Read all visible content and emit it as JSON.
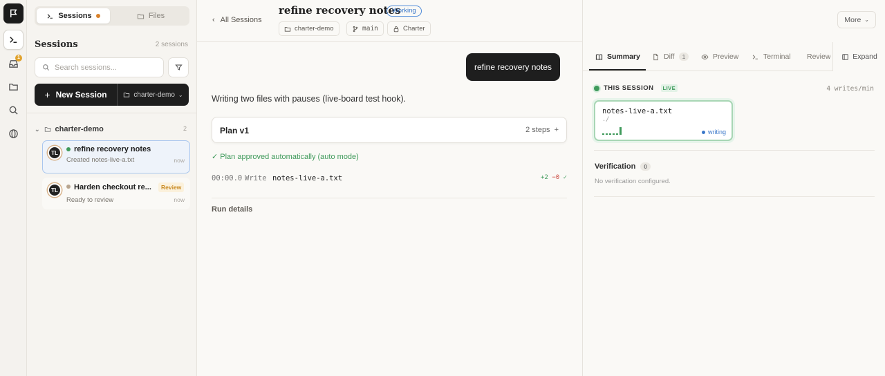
{
  "rail": {
    "inbox_count": "1"
  },
  "sidebar": {
    "tabs": [
      {
        "label": "Sessions"
      },
      {
        "label": "Files"
      }
    ],
    "title": "Sessions",
    "session_count": "2 sessions",
    "search_placeholder": "Search sessions...",
    "new_session_label": "New Session",
    "new_session_project": "charter-demo",
    "group": {
      "name": "charter-demo",
      "count": "2"
    },
    "sessions": [
      {
        "avatar": "TL",
        "title": "refine recovery notes",
        "subtitle": "Created notes-live-a.txt",
        "time": "now",
        "status_color": "#3f9a5b"
      },
      {
        "avatar": "TL",
        "title": "Harden checkout re...",
        "subtitle": "Ready to review",
        "time": "now",
        "badge": "Review",
        "status_color": "#b8a58f"
      }
    ]
  },
  "header": {
    "back_label": "All Sessions",
    "title": "refine recovery notes",
    "status": "Working",
    "chips": {
      "project": "charter-demo",
      "branch": "main",
      "charter": "Charter"
    }
  },
  "main": {
    "user_message": "refine recovery notes",
    "description": "Writing two files with pauses (live-board test hook).",
    "plan": {
      "title": "Plan v1",
      "steps": "2 steps",
      "expand": "+"
    },
    "approved": "✓ Plan approved automatically (auto mode)",
    "write": {
      "time": "00:00.0",
      "verb": "Write",
      "file": "notes-live-a.txt",
      "plus": "+2",
      "minus": "−0",
      "check": "✓"
    },
    "run_details": "Run details"
  },
  "right_panel": {
    "more_label": "More",
    "tabs": {
      "summary": "Summary",
      "diff": "Diff",
      "diff_count": "1",
      "preview": "Preview",
      "terminal": "Terminal",
      "review": "Review",
      "expand": "Expand"
    },
    "this_session": "THIS SESSION",
    "live": "LIVE",
    "writes": "4 writes/min",
    "file": {
      "name": "notes-live-a.txt",
      "path": "./",
      "status": "writing",
      "activity": [
        0.1,
        0.1,
        0.1,
        0.1,
        0.1,
        0.9
      ]
    },
    "verification": {
      "title": "Verification",
      "count": "0",
      "note": "No verification configured."
    }
  },
  "colors": {
    "accent_green": "#3f9a5b",
    "accent_blue": "#3b78c9",
    "review_orange": "#c98a22",
    "dark": "#1e1e1e"
  }
}
